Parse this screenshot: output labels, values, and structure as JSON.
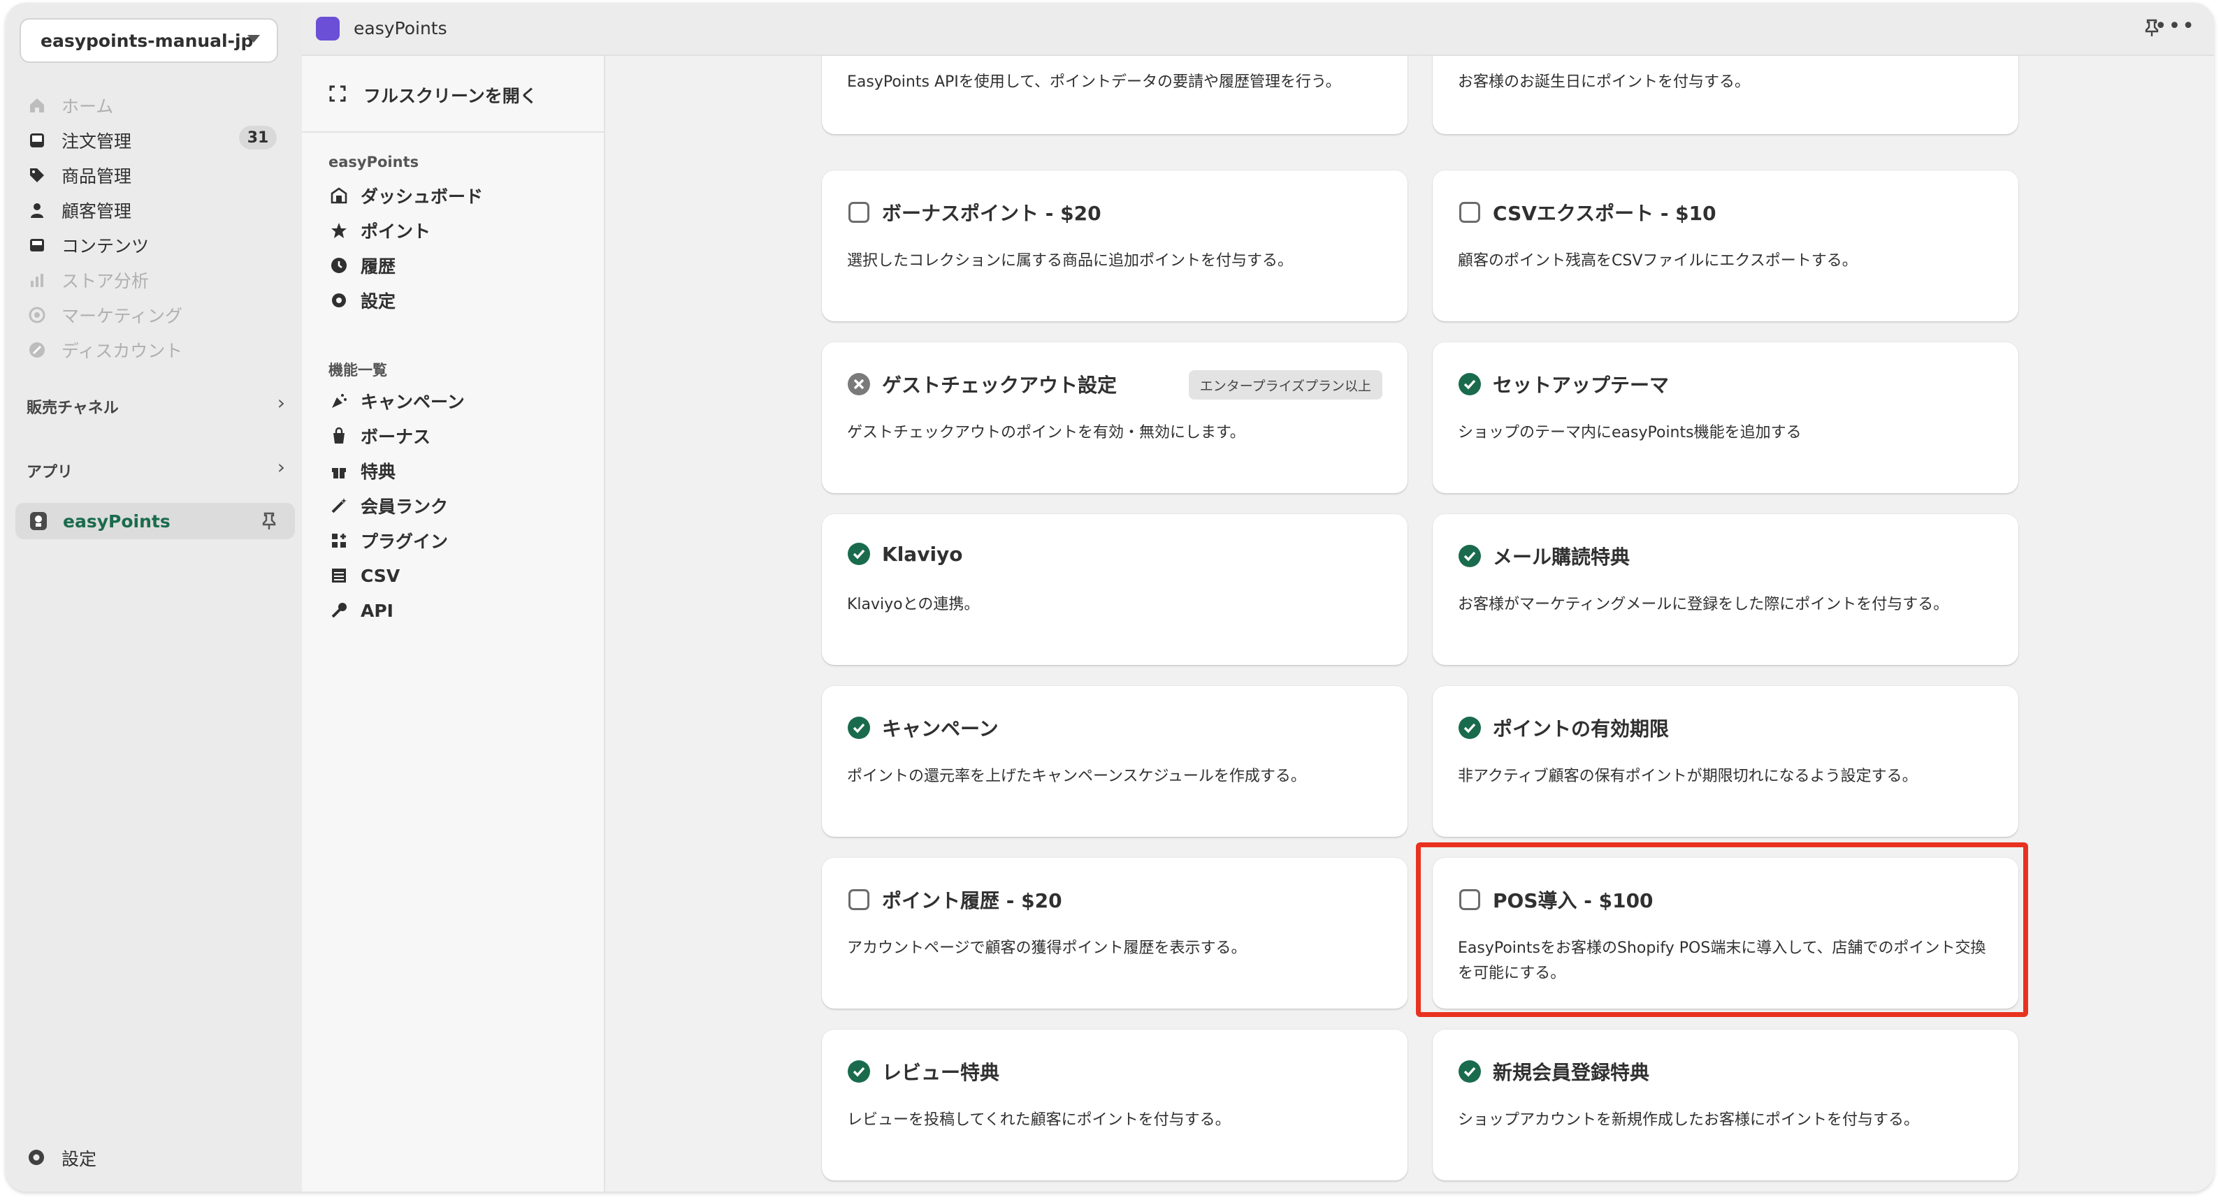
{
  "nav": {
    "store_name": "easypoints-manual-jp",
    "items": [
      {
        "label": "ホーム",
        "icon": "home-icon",
        "dim": true
      },
      {
        "label": "注文管理",
        "icon": "inbox-icon",
        "badge": "31"
      },
      {
        "label": "商品管理",
        "icon": "tag-icon"
      },
      {
        "label": "顧客管理",
        "icon": "person-icon"
      },
      {
        "label": "コンテンツ",
        "icon": "content-icon"
      },
      {
        "label": "ストア分析",
        "icon": "chart-icon",
        "dim": true
      },
      {
        "label": "マーケティング",
        "icon": "target-icon",
        "dim": true
      },
      {
        "label": "ディスカウント",
        "icon": "discount-icon",
        "dim": true
      }
    ],
    "sales_channels": "販売チャネル",
    "apps": "アプリ",
    "active_app": "easyPoints",
    "settings": "設定"
  },
  "topbar": {
    "title": "easyPoints"
  },
  "app_sidebar": {
    "fullscreen": "フルスクリーンを開く",
    "group1": "easyPoints",
    "group1_items": [
      "ダッシュボード",
      "ポイント",
      "履歴",
      "設定"
    ],
    "group2": "機能一覧",
    "group2_items": [
      "キャンペーン",
      "ボーナス",
      "特典",
      "会員ランク",
      "プラグイン",
      "CSV",
      "API"
    ]
  },
  "cards": [
    {
      "title": "",
      "desc": "EasyPoints APIを使用して、ポイントデータの要請や履歴管理を行う。",
      "status": "none"
    },
    {
      "title": "",
      "desc": "お客様のお誕生日にポイントを付与する。",
      "status": "none"
    },
    {
      "title": "ボーナスポイント - $20",
      "desc": "選択したコレクションに属する商品に追加ポイントを付与する。",
      "status": "unchecked"
    },
    {
      "title": "CSVエクスポート - $10",
      "desc": "顧客のポイント残高をCSVファイルにエクスポートする。",
      "status": "unchecked"
    },
    {
      "title": "ゲストチェックアウト設定",
      "desc": "ゲストチェックアウトのポイントを有効・無効にします。",
      "status": "disabled",
      "tag": "エンタープライズプラン以上"
    },
    {
      "title": "セットアップテーマ",
      "desc": "ショップのテーマ内にeasyPoints機能を追加する",
      "status": "enabled"
    },
    {
      "title": "Klaviyo",
      "desc": "Klaviyoとの連携。",
      "status": "enabled"
    },
    {
      "title": "メール購読特典",
      "desc": "お客様がマーケティングメールに登録をした際にポイントを付与する。",
      "status": "enabled"
    },
    {
      "title": "キャンペーン",
      "desc": "ポイントの還元率を上げたキャンペーンスケジュールを作成する。",
      "status": "enabled"
    },
    {
      "title": "ポイントの有効期限",
      "desc": "非アクティブ顧客の保有ポイントが期限切れになるよう設定する。",
      "status": "enabled"
    },
    {
      "title": "ポイント履歴 - $20",
      "desc": "アカウントページで顧客の獲得ポイント履歴を表示する。",
      "status": "unchecked"
    },
    {
      "title": "POS導入 - $100",
      "desc": "EasyPointsをお客様のShopify POS端末に導入して、店舗でのポイント交換を可能にする。",
      "status": "unchecked"
    },
    {
      "title": "レビュー特典",
      "desc": "レビューを投稿してくれた顧客にポイントを付与する。",
      "status": "enabled"
    },
    {
      "title": "新規会員登録特典",
      "desc": "ショップアカウントを新規作成したお客様にポイントを付与する。",
      "status": "enabled"
    }
  ],
  "colors": {
    "enabled": "#1a6b4d",
    "highlight": "#e8321f",
    "accent": "#6b4fd6"
  }
}
